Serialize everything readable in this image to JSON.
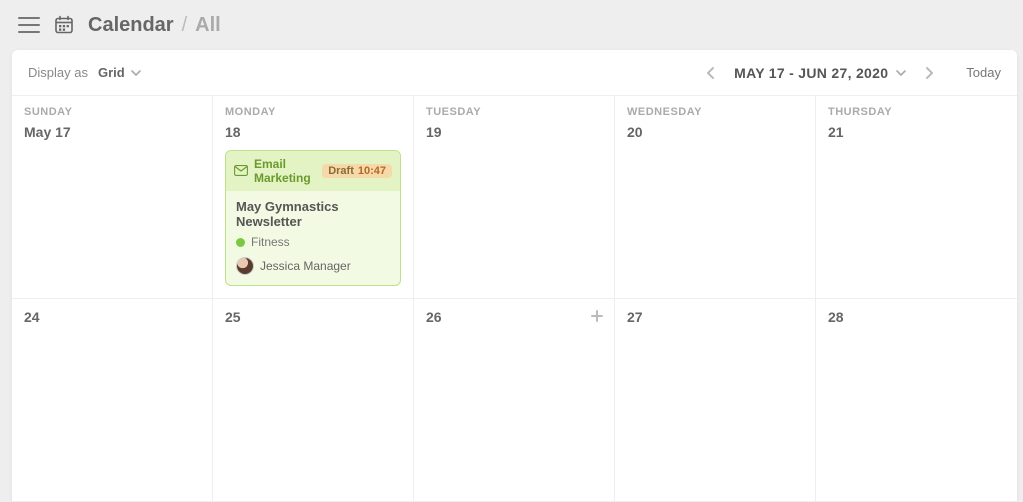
{
  "header": {
    "title": "Calendar",
    "section": "All"
  },
  "toolbar": {
    "display_as_label": "Display as",
    "display_as_value": "Grid",
    "date_range": "MAY 17 - JUN 27, 2020",
    "today_label": "Today"
  },
  "colors": {
    "event_border": "#bde28b",
    "event_bg": "#f2fae3",
    "event_head_bg": "#e3f3c4",
    "status_bg": "#f5d9a8",
    "tag_dot": "#7ac943"
  },
  "grid": {
    "days": [
      "SUNDAY",
      "MONDAY",
      "TUESDAY",
      "WEDNESDAY",
      "THURSDAY"
    ],
    "row1": [
      "May 17",
      "18",
      "19",
      "20",
      "21"
    ],
    "row2": [
      "24",
      "25",
      "26",
      "27",
      "28"
    ]
  },
  "event": {
    "type_label": "Email Marketing",
    "status_label": "Draft",
    "status_time": "10:47",
    "title": "May Gymnastics Newsletter",
    "tag": "Fitness",
    "user": "Jessica Manager"
  }
}
